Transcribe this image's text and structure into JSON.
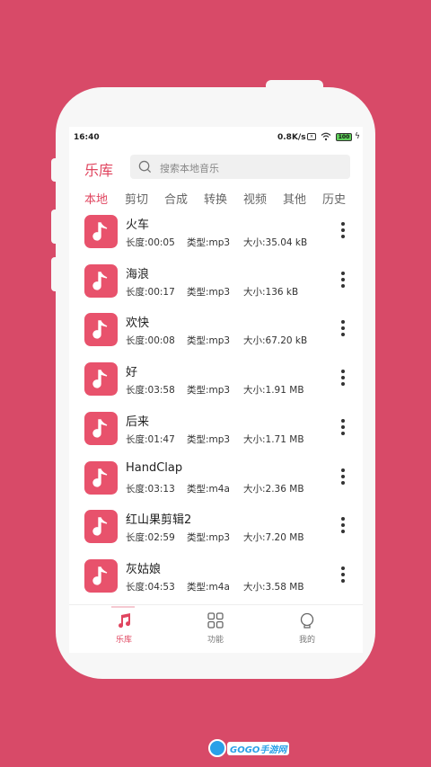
{
  "status_bar": {
    "time": "16:40",
    "speed": "0.8K/s",
    "battery": "100"
  },
  "header": {
    "title": "乐库",
    "search_placeholder": "搜索本地音乐"
  },
  "tabs": [
    "本地",
    "剪切",
    "合成",
    "转换",
    "视频",
    "其他",
    "历史"
  ],
  "active_tab": 0,
  "songs": [
    {
      "name": "火车",
      "duration": "长度:00:05",
      "type": "类型:mp3",
      "size": "大小:35.04 kB"
    },
    {
      "name": "海浪",
      "duration": "长度:00:17",
      "type": "类型:mp3",
      "size": "大小:136 kB"
    },
    {
      "name": "欢快",
      "duration": "长度:00:08",
      "type": "类型:mp3",
      "size": "大小:67.20 kB"
    },
    {
      "name": "好",
      "duration": "长度:03:58",
      "type": "类型:mp3",
      "size": "大小:1.91 MB"
    },
    {
      "name": "后来",
      "duration": "长度:01:47",
      "type": "类型:mp3",
      "size": "大小:1.71 MB"
    },
    {
      "name": "HandClap",
      "duration": "长度:03:13",
      "type": "类型:m4a",
      "size": "大小:2.36 MB"
    },
    {
      "name": "红山果剪辑2",
      "duration": "长度:02:59",
      "type": "类型:mp3",
      "size": "大小:7.20 MB"
    },
    {
      "name": "灰姑娘",
      "duration": "长度:04:53",
      "type": "类型:m4a",
      "size": "大小:3.58 MB"
    }
  ],
  "bottom_nav": [
    {
      "label": "乐库",
      "icon": "music-note-icon"
    },
    {
      "label": "功能",
      "icon": "grid-icon"
    },
    {
      "label": "我的",
      "icon": "profile-icon"
    }
  ],
  "watermark": "GOGO手游网",
  "colors": {
    "background": "#d84a68",
    "accent": "#e0455f",
    "thumb": "#e8526c"
  }
}
